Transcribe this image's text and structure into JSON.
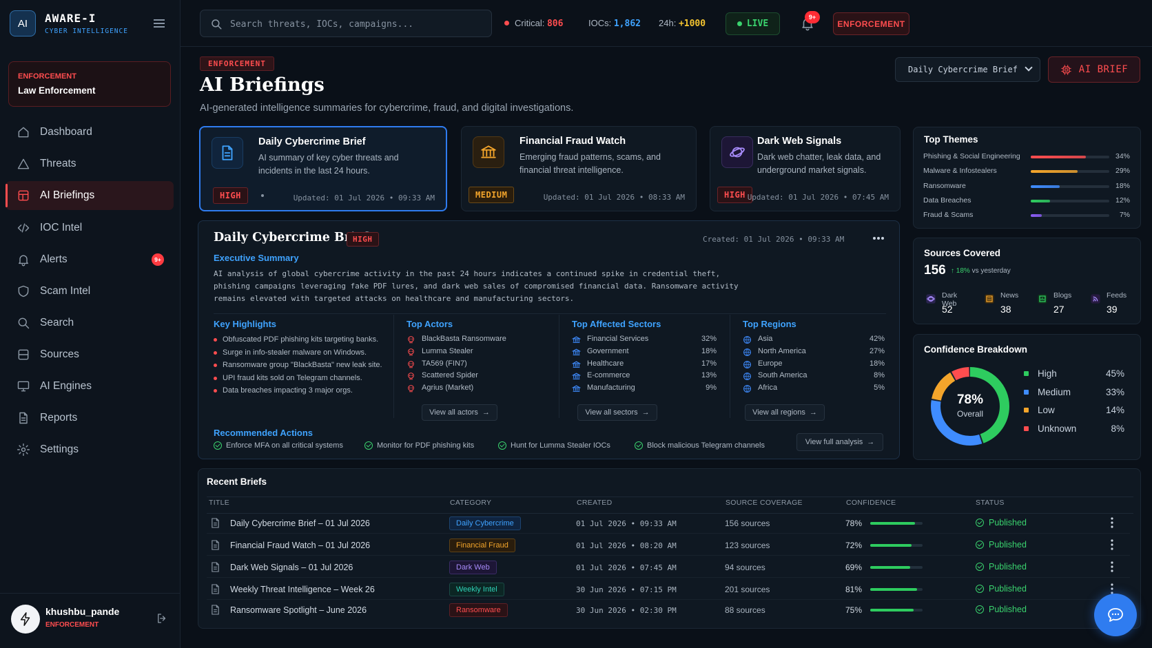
{
  "brand": {
    "logo": "AI",
    "title": "AWARE-I",
    "subtitle": "CYBER INTELLIGENCE"
  },
  "role_card": {
    "label": "ENFORCEMENT",
    "value": "Law Enforcement"
  },
  "nav": [
    {
      "label": "Dashboard",
      "icon": "home-icon"
    },
    {
      "label": "Threats",
      "icon": "warning-icon"
    },
    {
      "label": "AI Briefings",
      "icon": "grid-icon",
      "active": true
    },
    {
      "label": "IOC Intel",
      "icon": "code-icon"
    },
    {
      "label": "Alerts",
      "icon": "bell-icon",
      "badge": "9+"
    },
    {
      "label": "Scam Intel",
      "icon": "shield-icon"
    },
    {
      "label": "Search",
      "icon": "search-icon"
    },
    {
      "label": "Sources",
      "icon": "database-icon"
    },
    {
      "label": "AI Engines",
      "icon": "monitor-icon"
    },
    {
      "label": "Reports",
      "icon": "document-icon"
    },
    {
      "label": "Settings",
      "icon": "gear-icon"
    }
  ],
  "user": {
    "name": "khushbu_pande",
    "role": "ENFORCEMENT"
  },
  "topbar": {
    "search_placeholder": "Search threats, IOCs, campaigns...",
    "critical_label": "Critical:",
    "critical_value": "806",
    "iocs_label": "IOCs:",
    "iocs_value": "1,862",
    "h24_label": "24h:",
    "h24_value": "+1000",
    "live": "LIVE",
    "bell_badge": "9+",
    "enforcement": "ENFORCEMENT"
  },
  "page": {
    "tag": "ENFORCEMENT",
    "title": "AI Briefings",
    "subtitle": "AI-generated intelligence summaries for cybercrime, fraud, and digital investigations.",
    "select_value": "Daily Cybercrime Brief",
    "ai_brief_button": "AI BRIEF"
  },
  "brief_cards": [
    {
      "title": "Daily Cybercrime Brief",
      "desc": "AI summary of key cyber threats and incidents in the last 24 hours.",
      "severity": "HIGH",
      "updated": "Updated: 01 Jul 2026 • 09:33 AM"
    },
    {
      "title": "Financial Fraud Watch",
      "desc": "Emerging fraud patterns, scams, and financial threat intelligence.",
      "severity": "MEDIUM",
      "updated": "Updated: 01 Jul 2026 • 08:33 AM"
    },
    {
      "title": "Dark Web Signals",
      "desc": "Dark web chatter, leak data, and underground market signals.",
      "severity": "HIGH",
      "updated": "Updated: 01 Jul 2026 • 07:45 AM"
    }
  ],
  "detail": {
    "title": "Daily Cybercrime Brief",
    "severity": "HIGH",
    "created": "Created: 01 Jul 2026 • 09:33 AM",
    "exec_heading": "Executive Summary",
    "exec_text": "AI analysis of global cybercrime activity in the past 24 hours indicates a continued spike in credential theft, phishing campaigns leveraging fake PDF lures, and dark web sales of compromised financial data. Ransomware activity remains elevated with targeted attacks on healthcare and manufacturing sectors.",
    "highlights_heading": "Key Highlights",
    "highlights": [
      "Obfuscated PDF phishing kits targeting banks.",
      "Surge in info-stealer malware on Windows.",
      "Ransomware group \"BlackBasta\" new leak site.",
      "UPI fraud kits sold on Telegram channels.",
      "Data breaches impacting 3 major orgs."
    ],
    "actors_heading": "Top Actors",
    "actors": [
      "BlackBasta Ransomware",
      "Lumma Stealer",
      "TA569 (FIN7)",
      "Scattered Spider",
      "Agrius (Market)"
    ],
    "actors_button": "View all actors",
    "sectors_heading": "Top Affected Sectors",
    "sectors": [
      {
        "name": "Financial Services",
        "value": "32%"
      },
      {
        "name": "Government",
        "value": "18%"
      },
      {
        "name": "Healthcare",
        "value": "17%"
      },
      {
        "name": "E-commerce",
        "value": "13%"
      },
      {
        "name": "Manufacturing",
        "value": "9%"
      }
    ],
    "sectors_button": "View all sectors",
    "regions_heading": "Top Regions",
    "regions": [
      {
        "name": "Asia",
        "value": "42%"
      },
      {
        "name": "North America",
        "value": "27%"
      },
      {
        "name": "Europe",
        "value": "18%"
      },
      {
        "name": "South America",
        "value": "8%"
      },
      {
        "name": "Africa",
        "value": "5%"
      }
    ],
    "regions_button": "View all regions",
    "actions_heading": "Recommended Actions",
    "actions": [
      "Enforce MFA on all critical systems",
      "Monitor for PDF phishing kits",
      "Hunt for Lumma Stealer IOCs",
      "Block malicious Telegram channels"
    ],
    "full_button": "View full analysis"
  },
  "themes": {
    "title": "Top Themes",
    "items": [
      {
        "name": "Phishing & Social Engineering",
        "value": "34%",
        "pct": 34,
        "color": "#ff4d4f"
      },
      {
        "name": "Malware & Infostealers",
        "value": "29%",
        "pct": 29,
        "color": "#f4a52b"
      },
      {
        "name": "Ransomware",
        "value": "18%",
        "pct": 18,
        "color": "#3f8cff"
      },
      {
        "name": "Data Breaches",
        "value": "12%",
        "pct": 12,
        "color": "#2ecc5f"
      },
      {
        "name": "Fraud & Scams",
        "value": "7%",
        "pct": 7,
        "color": "#8b5cf6"
      }
    ]
  },
  "sources": {
    "title": "Sources Covered",
    "total": "156",
    "delta": "↑ 18%",
    "delta_suffix": "vs yesterday",
    "items": [
      {
        "label": "Dark Web",
        "value": "52"
      },
      {
        "label": "News",
        "value": "38"
      },
      {
        "label": "Blogs",
        "value": "27"
      },
      {
        "label": "Feeds",
        "value": "39"
      }
    ]
  },
  "confidence": {
    "title": "Confidence Breakdown",
    "center_value": "78%",
    "center_label": "Overall",
    "items": [
      {
        "name": "High",
        "value": "45%",
        "pct": 45,
        "color": "#2ecc5f"
      },
      {
        "name": "Medium",
        "value": "33%",
        "pct": 33,
        "color": "#3f8cff"
      },
      {
        "name": "Low",
        "value": "14%",
        "pct": 14,
        "color": "#f4a52b"
      },
      {
        "name": "Unknown",
        "value": "8%",
        "pct": 8,
        "color": "#ff4d4f"
      }
    ]
  },
  "recent": {
    "title": "Recent Briefs",
    "columns": [
      "TITLE",
      "CATEGORY",
      "CREATED",
      "SOURCE COVERAGE",
      "CONFIDENCE",
      "STATUS"
    ],
    "rows": [
      {
        "title": "Daily Cybercrime Brief – 01 Jul 2026",
        "category": "Daily Cybercrime",
        "cat_color": "#3fa3ff",
        "cat_bg": "#0f2440",
        "cat_border": "#1d4470",
        "created": "01 Jul 2026  •  09:33 AM",
        "sources": "156 sources",
        "confidence": "78%",
        "conf_pct": 78,
        "status": "Published"
      },
      {
        "title": "Financial Fraud Watch – 01 Jul 2026",
        "category": "Financial Fraud",
        "cat_color": "#f4a52b",
        "cat_bg": "#2a1d0c",
        "cat_border": "#5e4216",
        "created": "01 Jul 2026  •  08:20 AM",
        "sources": "123 sources",
        "confidence": "72%",
        "conf_pct": 72,
        "status": "Published"
      },
      {
        "title": "Dark Web Signals – 01 Jul 2026",
        "category": "Dark Web",
        "cat_color": "#a78bfa",
        "cat_bg": "#1d1636",
        "cat_border": "#3a2c66",
        "created": "01 Jul 2026  •  07:45 AM",
        "sources": "94 sources",
        "confidence": "69%",
        "conf_pct": 69,
        "status": "Published"
      },
      {
        "title": "Weekly Threat Intelligence – Week 26",
        "category": "Weekly Intel",
        "cat_color": "#2ed3b7",
        "cat_bg": "#0c2624",
        "cat_border": "#1a4a45",
        "created": "30 Jun 2026  •  07:15 PM",
        "sources": "201 sources",
        "confidence": "81%",
        "conf_pct": 81,
        "status": "Published"
      },
      {
        "title": "Ransomware Spotlight – June 2026",
        "category": "Ransomware",
        "cat_color": "#ff4d4f",
        "cat_bg": "#2a1216",
        "cat_border": "#5e1f25",
        "created": "30 Jun 2026  •  02:30 PM",
        "sources": "88 sources",
        "confidence": "75%",
        "conf_pct": 75,
        "status": "Published"
      }
    ]
  }
}
